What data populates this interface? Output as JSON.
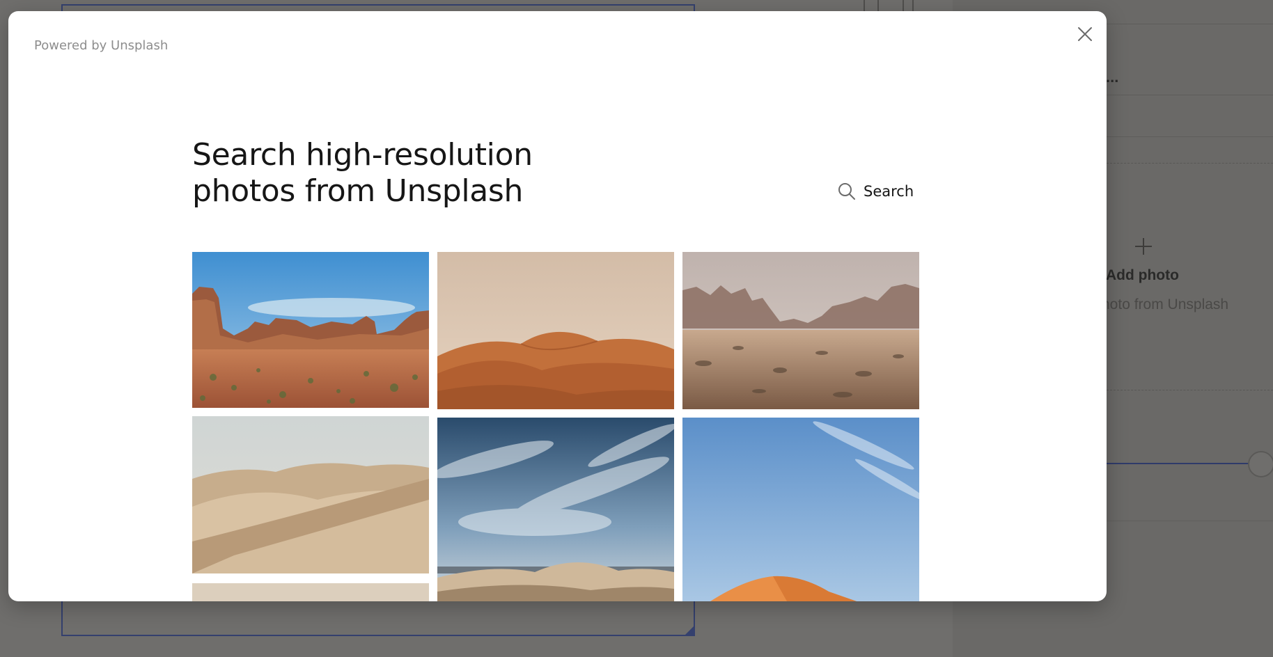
{
  "background": {
    "panel": {
      "truncated_label": "...",
      "add_photo_label": "Add photo",
      "add_photo_subtitle": "hoto from Unsplash"
    }
  },
  "modal": {
    "powered_by": "Powered by Unsplash",
    "close_icon": "close-icon",
    "title_line1": "Search high-resolution",
    "title_line2": "photos from Unsplash",
    "search": {
      "icon": "search-icon",
      "label": "Search"
    },
    "photos": [
      {
        "subject": "red rock buttes desert"
      },
      {
        "subject": "sand dunes at dusk"
      },
      {
        "subject": "rocky desert with haze"
      },
      {
        "subject": "pale sand dunes"
      },
      {
        "subject": "dunes under cloudy blue sky"
      },
      {
        "subject": "orange dune under blue sky"
      },
      {
        "subject": "beige sand"
      }
    ]
  },
  "colors": {
    "overlay": "#6f6e6c",
    "modal_bg": "#ffffff",
    "accent_frame": "#34406e",
    "muted_text": "#8d8d8d"
  }
}
